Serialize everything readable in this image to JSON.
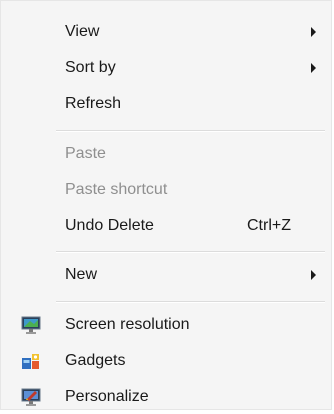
{
  "menu": {
    "items": [
      {
        "label": "View",
        "submenu": true
      },
      {
        "label": "Sort by",
        "submenu": true
      },
      {
        "label": "Refresh"
      },
      {
        "label": "Paste",
        "disabled": true
      },
      {
        "label": "Paste shortcut",
        "disabled": true
      },
      {
        "label": "Undo Delete",
        "shortcut": "Ctrl+Z"
      },
      {
        "label": "New",
        "submenu": true
      },
      {
        "label": "Screen resolution",
        "icon": "screen-resolution-icon"
      },
      {
        "label": "Gadgets",
        "icon": "gadgets-icon"
      },
      {
        "label": "Personalize",
        "icon": "personalize-icon"
      }
    ]
  },
  "colors": {
    "background": "#f5f5f5",
    "text": "#1a1a1a",
    "disabled_text": "#8f8f8f",
    "separator": "#dcdcdc"
  }
}
